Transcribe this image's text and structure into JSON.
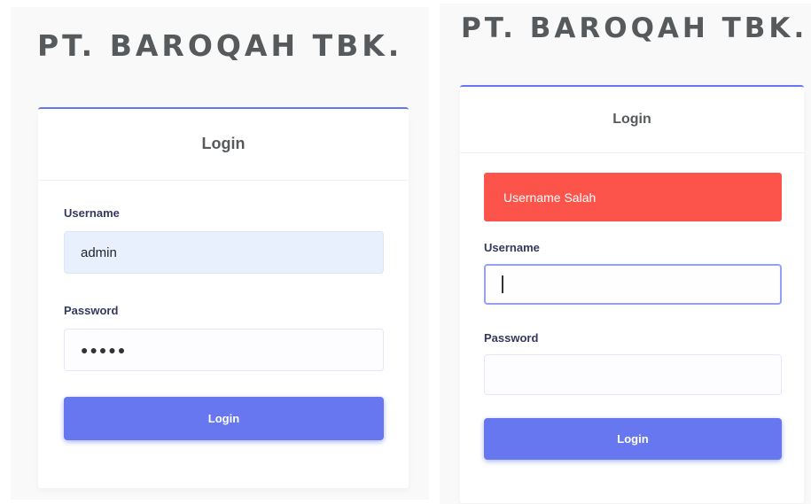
{
  "brand_title": "PT. BAROQAH TBK.",
  "left": {
    "card_title": "Login",
    "username_label": "Username",
    "username_value": "admin",
    "password_label": "Password",
    "password_mask": "●●●●●",
    "login_button": "Login"
  },
  "right": {
    "card_title": "Login",
    "alert_text": "Username Salah",
    "username_label": "Username",
    "username_value": "",
    "password_label": "Password",
    "password_value": "",
    "login_button": "Login"
  },
  "colors": {
    "primary": "#6777ef",
    "danger": "#fc544b",
    "brand_text": "#575a5c"
  }
}
